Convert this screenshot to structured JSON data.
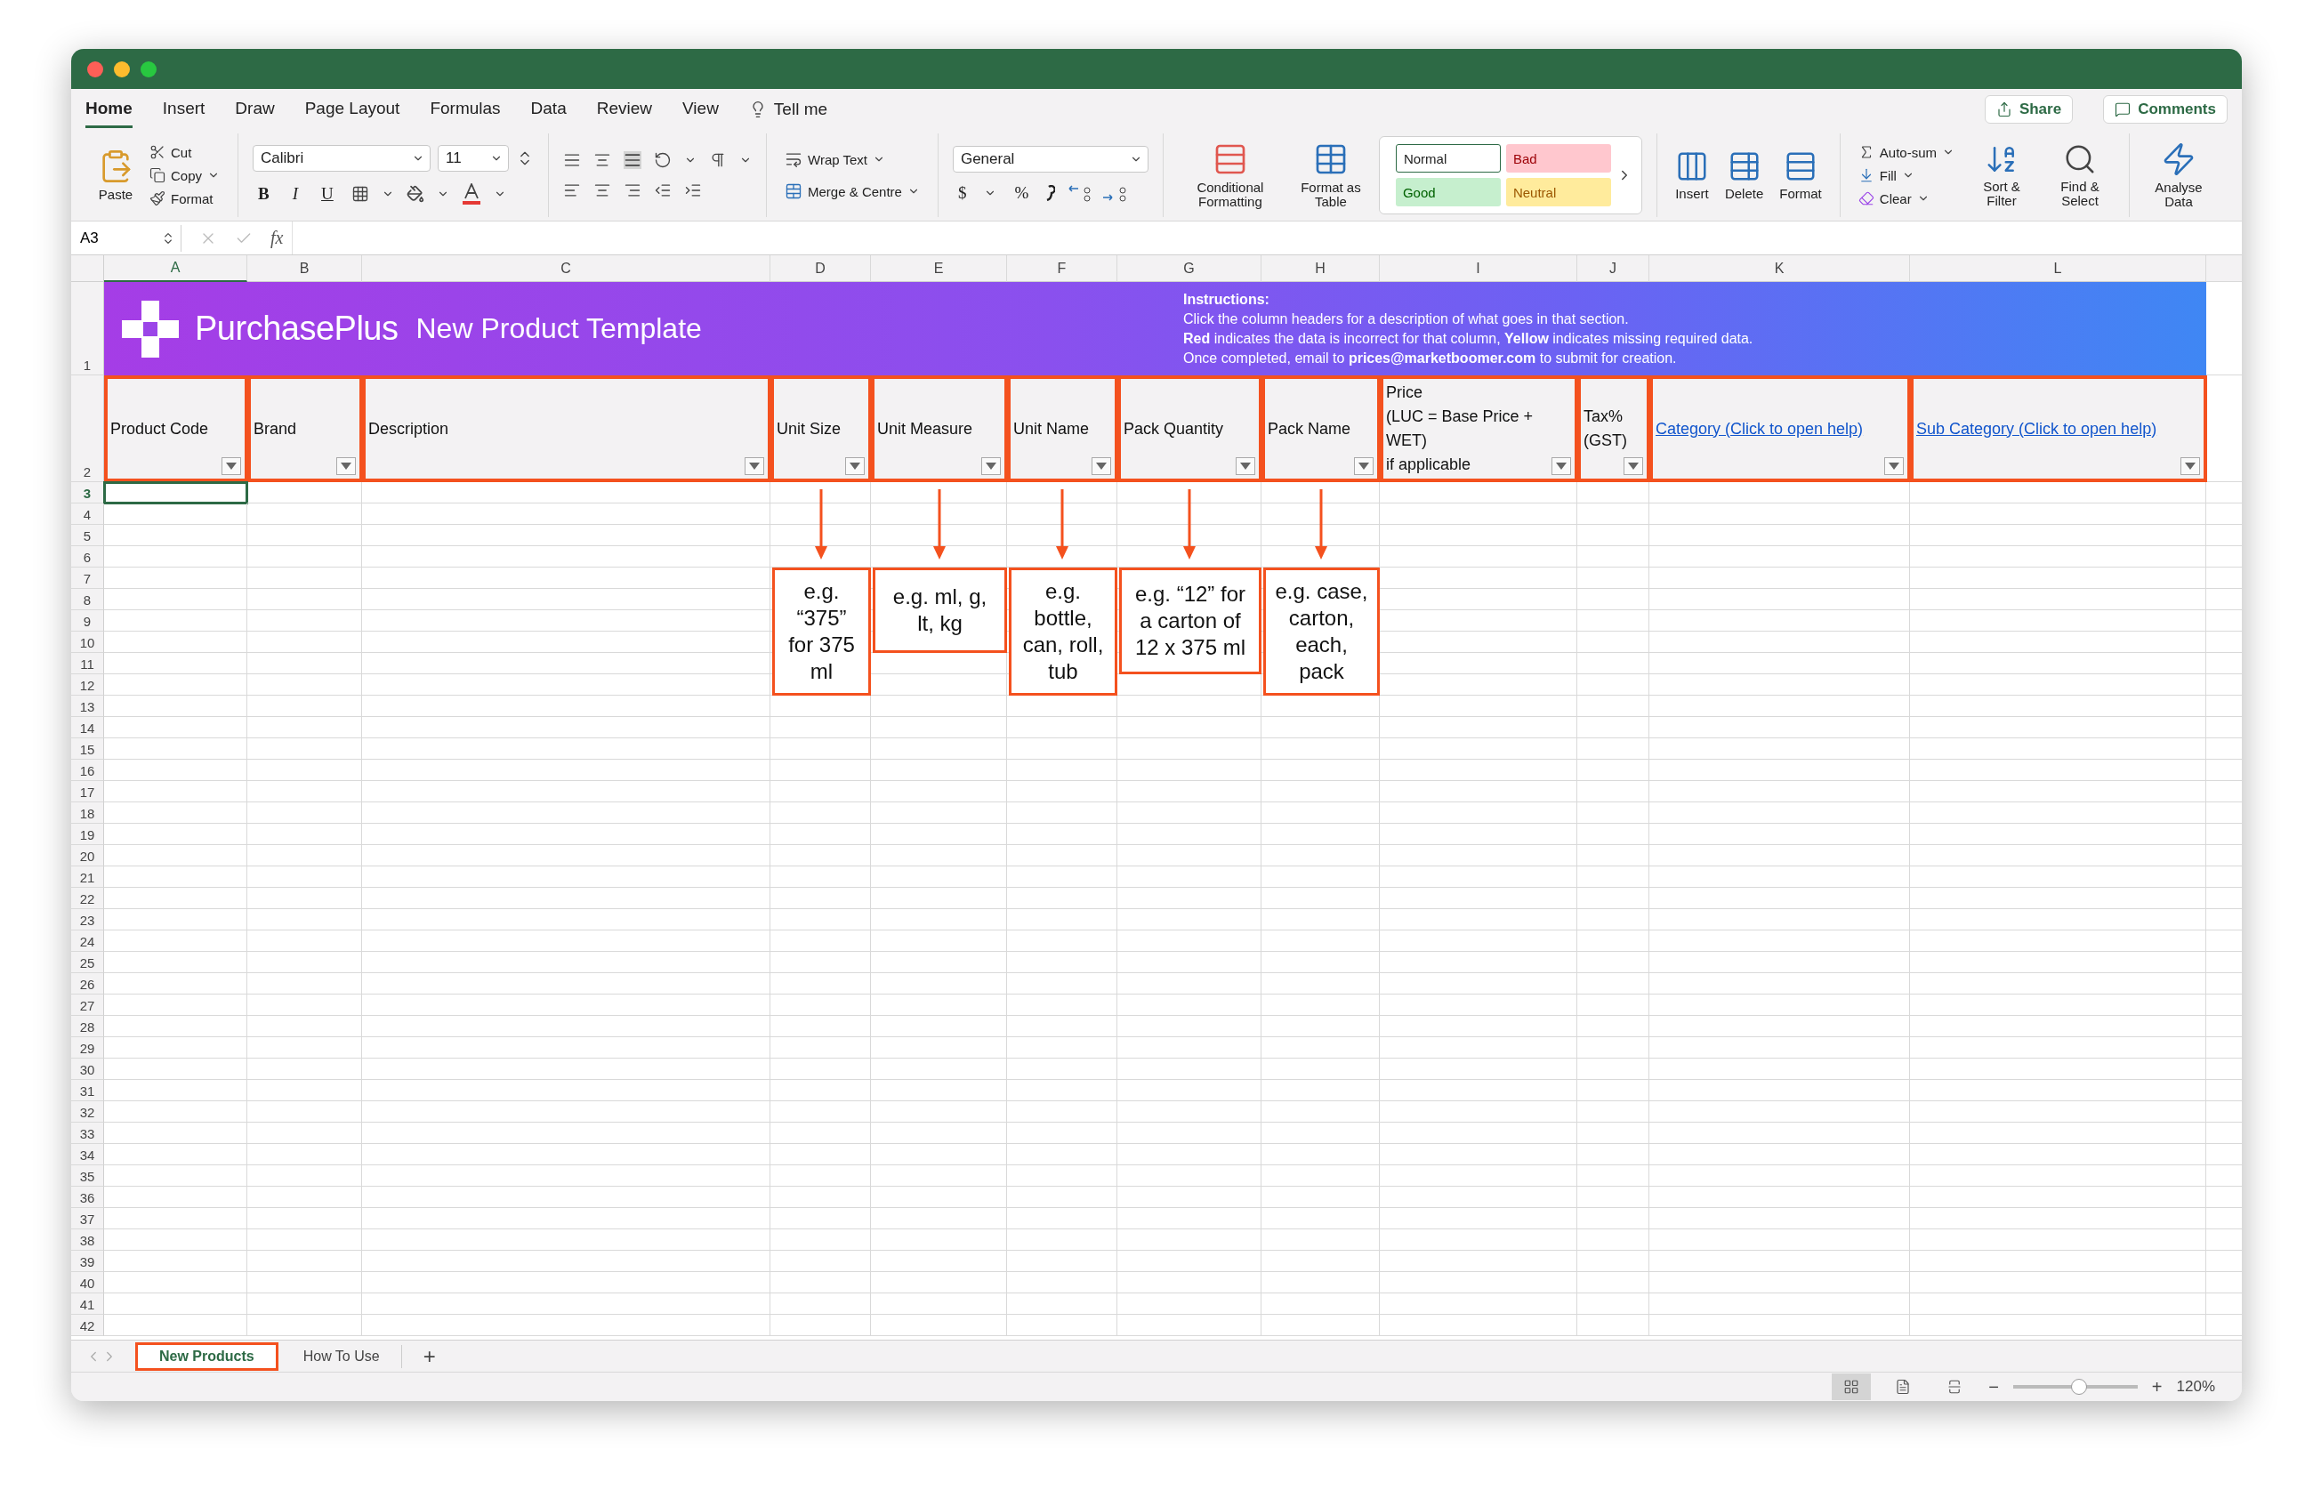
{
  "menu": {
    "tabs": [
      {
        "label": "Home",
        "selected": true
      },
      {
        "label": "Insert",
        "selected": false
      },
      {
        "label": "Draw",
        "selected": false
      },
      {
        "label": "Page Layout",
        "selected": false
      },
      {
        "label": "Formulas",
        "selected": false
      },
      {
        "label": "Data",
        "selected": false
      },
      {
        "label": "Review",
        "selected": false
      },
      {
        "label": "View",
        "selected": false
      }
    ],
    "tell_me": "Tell me",
    "share": "Share",
    "comments": "Comments"
  },
  "ribbon": {
    "clipboard": {
      "paste": "Paste",
      "cut": "Cut",
      "copy": "Copy",
      "format": "Format"
    },
    "font": {
      "name": "Calibri",
      "size": "11",
      "bold": "B",
      "italic": "I",
      "underline": "U"
    },
    "wrap_text": "Wrap Text",
    "merge": "Merge & Centre",
    "number": {
      "format": "General",
      "currency": "$",
      "percent": "%"
    },
    "conditional_formatting": "Conditional Formatting",
    "format_as_table": "Format as Table",
    "styles": [
      {
        "label": "Normal",
        "color": "#ffffff"
      },
      {
        "label": "Bad",
        "color": "#ffc7ce"
      },
      {
        "label": "Good",
        "color": "#c6efce"
      },
      {
        "label": "Neutral",
        "color": "#ffeb9c"
      }
    ],
    "cells": [
      "Insert",
      "Delete",
      "Format"
    ],
    "editing": {
      "autosum": "Auto-sum",
      "fill": "Fill",
      "clear": "Clear",
      "sort": "Sort & Filter",
      "find": "Find & Select"
    },
    "analyse": "Analyse Data"
  },
  "formula_bar": {
    "name_box": "A3",
    "fx": "fx"
  },
  "columns": [
    {
      "label": "A",
      "selected": true
    },
    {
      "label": "B",
      "selected": false
    },
    {
      "label": "C",
      "selected": false
    },
    {
      "label": "D",
      "selected": false
    },
    {
      "label": "E",
      "selected": false
    },
    {
      "label": "F",
      "selected": false
    },
    {
      "label": "G",
      "selected": false
    },
    {
      "label": "H",
      "selected": false
    },
    {
      "label": "I",
      "selected": false
    },
    {
      "label": "J",
      "selected": false
    },
    {
      "label": "K",
      "selected": false
    },
    {
      "label": "L",
      "selected": false
    }
  ],
  "rows": [
    {
      "label": "1",
      "selected": false
    },
    {
      "label": "2",
      "selected": false
    },
    {
      "label": "3",
      "selected": true
    },
    {
      "label": "4",
      "selected": false
    },
    {
      "label": "5",
      "selected": false
    },
    {
      "label": "6",
      "selected": false
    },
    {
      "label": "7",
      "selected": false
    },
    {
      "label": "8",
      "selected": false
    },
    {
      "label": "9",
      "selected": false
    },
    {
      "label": "10",
      "selected": false
    },
    {
      "label": "11",
      "selected": false
    },
    {
      "label": "12",
      "selected": false
    },
    {
      "label": "13",
      "selected": false
    },
    {
      "label": "14",
      "selected": false
    },
    {
      "label": "15",
      "selected": false
    },
    {
      "label": "16",
      "selected": false
    },
    {
      "label": "17",
      "selected": false
    },
    {
      "label": "18",
      "selected": false
    },
    {
      "label": "19",
      "selected": false
    },
    {
      "label": "20",
      "selected": false
    },
    {
      "label": "21",
      "selected": false
    },
    {
      "label": "22",
      "selected": false
    },
    {
      "label": "23",
      "selected": false
    },
    {
      "label": "24",
      "selected": false
    },
    {
      "label": "25",
      "selected": false
    },
    {
      "label": "26",
      "selected": false
    },
    {
      "label": "27",
      "selected": false
    },
    {
      "label": "28",
      "selected": false
    },
    {
      "label": "29",
      "selected": false
    },
    {
      "label": "30",
      "selected": false
    },
    {
      "label": "31",
      "selected": false
    },
    {
      "label": "32",
      "selected": false
    },
    {
      "label": "33",
      "selected": false
    },
    {
      "label": "34",
      "selected": false
    },
    {
      "label": "35",
      "selected": false
    },
    {
      "label": "36",
      "selected": false
    },
    {
      "label": "37",
      "selected": false
    },
    {
      "label": "38",
      "selected": false
    },
    {
      "label": "39",
      "selected": false
    },
    {
      "label": "40",
      "selected": false
    },
    {
      "label": "41",
      "selected": false
    },
    {
      "label": "42",
      "selected": false
    }
  ],
  "banner": {
    "brand": "Purchase**Plus**",
    "title": "New Product Template",
    "instructions_heading": "Instructions:",
    "instructions": [
      "Click the column headers for a description of what goes in that section.",
      "**Red** indicates the data is incorrect for that column, **Yellow** indicates missing required data.",
      "Once completed, email to **prices@marketboomer.com** to submit for creation."
    ]
  },
  "headers": [
    {
      "label": "Product Code",
      "kind": "text"
    },
    {
      "label": "Brand",
      "kind": "text"
    },
    {
      "label": "Description",
      "kind": "text"
    },
    {
      "label": "Unit Size",
      "kind": "text"
    },
    {
      "label": "Unit Measure",
      "kind": "text"
    },
    {
      "label": "Unit Name",
      "kind": "text"
    },
    {
      "label": "Pack Quantity",
      "kind": "text"
    },
    {
      "label": "Pack Name",
      "kind": "text"
    },
    {
      "label": "Price\n(LUC = Base Price + WET)\nif applicable",
      "kind": "text"
    },
    {
      "label": "Tax% (GST)",
      "kind": "text"
    },
    {
      "label": "Category (Click to open help)",
      "kind": "link"
    },
    {
      "label": "Sub Category (Click to open help)",
      "kind": "link"
    }
  ],
  "callouts": [
    "e.g. “375” for 375 ml",
    "e.g. ml, g, lt, kg",
    "e.g. bottle, can, roll, tub",
    "e.g. “12” for a carton of 12 x 375 ml",
    "e.g. case, carton, each, pack"
  ],
  "sheet_tabs": [
    {
      "label": "New Products",
      "selected": true
    },
    {
      "label": "How To Use",
      "selected": false
    }
  ],
  "add_sheet": "+",
  "status_bar": {
    "views": [
      {
        "kind": "normal",
        "selected": true
      },
      {
        "kind": "page_layout",
        "selected": false
      },
      {
        "kind": "page_break",
        "selected": false
      }
    ],
    "zoom_out": "−",
    "zoom_in": "+",
    "zoom_slider": {
      "level": 0.53
    },
    "zoom": "120%"
  }
}
